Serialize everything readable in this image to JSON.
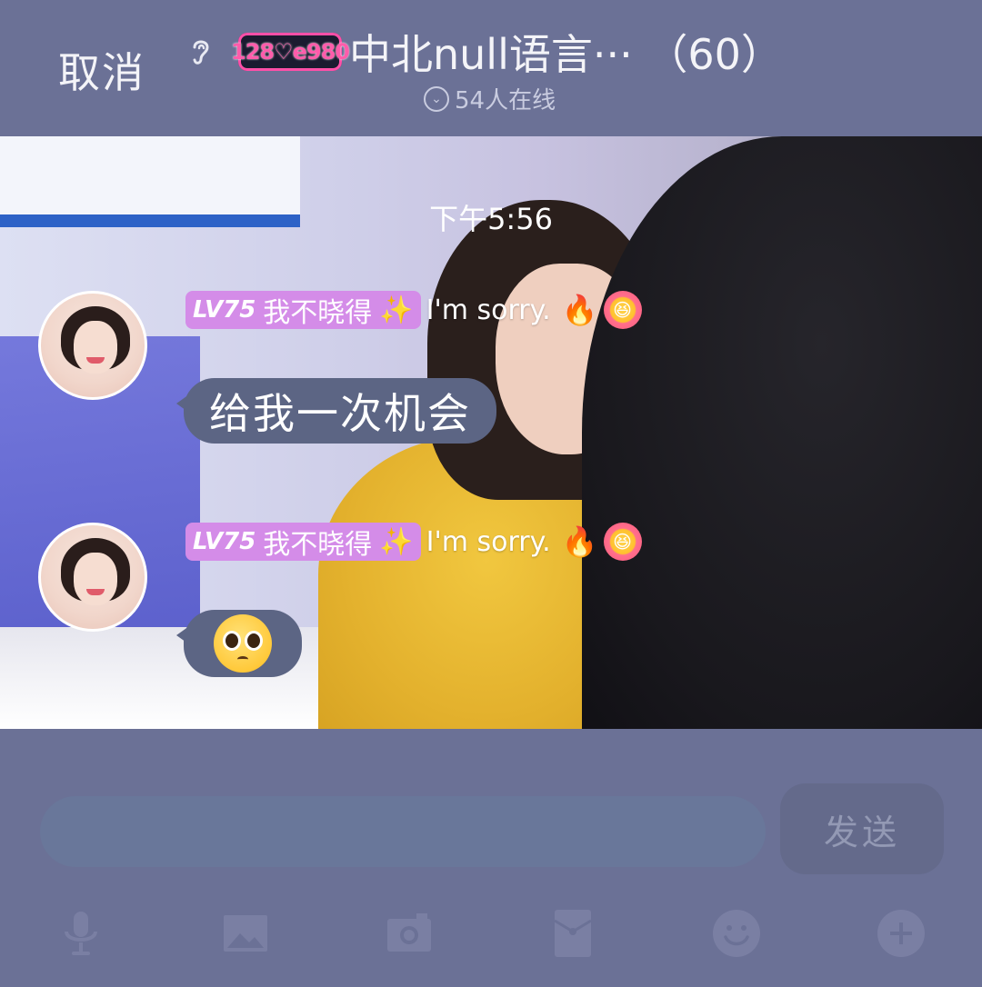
{
  "header": {
    "cancel_label": "取消",
    "logo_text": "128♡e980",
    "group_title": "中北null语言··· （60）",
    "online_text": "54人在线"
  },
  "chat": {
    "timestamp": "下午5:56",
    "messages": [
      {
        "level": "LV75",
        "title_badge": "我不晓得",
        "signature": "I'm sorry.",
        "text": "给我一次机会",
        "type": "text"
      },
      {
        "level": "LV75",
        "title_badge": "我不晓得",
        "signature": "I'm sorry.",
        "text": "",
        "type": "sticker",
        "sticker": "pleading-face"
      }
    ]
  },
  "input": {
    "placeholder": "",
    "send_label": "发送"
  },
  "toolbar": {
    "icons": [
      "microphone-icon",
      "image-icon",
      "camera-icon",
      "red-packet-icon",
      "emoji-icon",
      "plus-icon"
    ]
  },
  "colors": {
    "background": "#6b7196",
    "bubble": "#5c6584",
    "level_badge": "#d48ce8",
    "input": "#69779a",
    "send_button": "#646a8b"
  }
}
